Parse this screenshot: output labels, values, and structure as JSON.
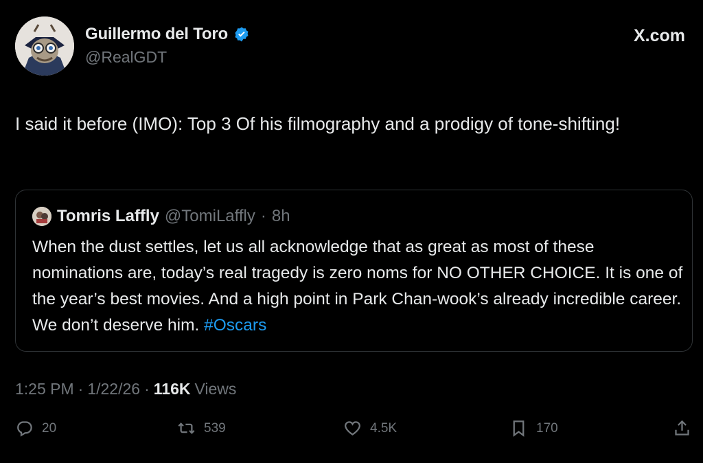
{
  "author": {
    "display_name": "Guillermo del Toro",
    "handle": "@RealGDT",
    "verified": true
  },
  "brand": "X.com",
  "tweet": {
    "text": "I said it before (IMO):  Top 3 Of his filmography and a prodigy of tone-shifting!"
  },
  "quote": {
    "display_name": "Tomris Laffly",
    "handle": "@TomiLaffly",
    "separator": "·",
    "time": "8h",
    "text_main": "When the dust settles, let us all acknowledge that as great as most of these nominations are, today’s real tragedy is zero noms for NO OTHER CHOICE. It is one of the year’s best movies. And a high point in Park Chan-wook’s already incredible career. We don’t deserve him. ",
    "hashtag": "#Oscars"
  },
  "meta": {
    "time": "1:25 PM",
    "sep1": "·",
    "date": "1/22/26",
    "sep2": "·",
    "views_count": "116K",
    "views_label": "Views"
  },
  "actions": {
    "replies": "20",
    "reposts": "539",
    "likes": "4.5K",
    "bookmarks": "170"
  },
  "colors": {
    "background": "#000000",
    "text": "#e7e9ea",
    "secondary": "#71767b",
    "accent": "#1d9bf0",
    "border": "#2f3336"
  },
  "icons": [
    "verified-badge-icon",
    "reply-icon",
    "repost-icon",
    "like-icon",
    "bookmark-icon",
    "share-icon"
  ]
}
